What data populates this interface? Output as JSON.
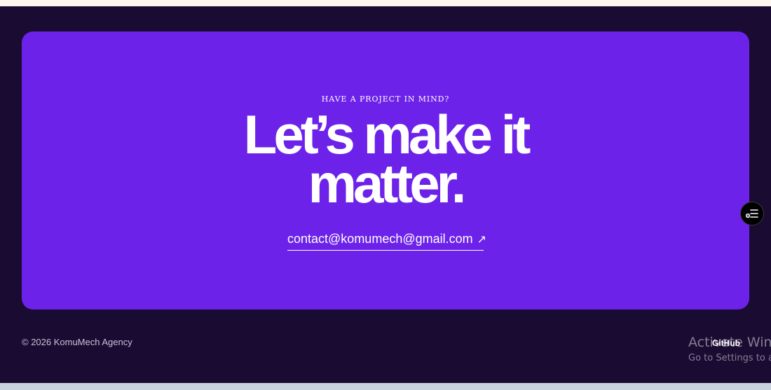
{
  "cta": {
    "eyebrow": "HAVE A PROJECT IN MIND?",
    "headline_line1": "Let’s make it",
    "headline_line2": "matter.",
    "email": "contact@komumech@gmail.com",
    "email_arrow": "↗"
  },
  "footer": {
    "copyright": "© 2026 KomuMech Agency",
    "github_label": "GitHub"
  },
  "watermark": {
    "title": "Activate Windows",
    "subtitle": "Go to Settings to activate Windows."
  },
  "icons": {
    "fab": "settings-list-icon",
    "arrow": "arrow-up-right-icon"
  },
  "colors": {
    "page_background": "#1a0b32",
    "card_background": "#6d22ea",
    "text": "#ffffff"
  }
}
